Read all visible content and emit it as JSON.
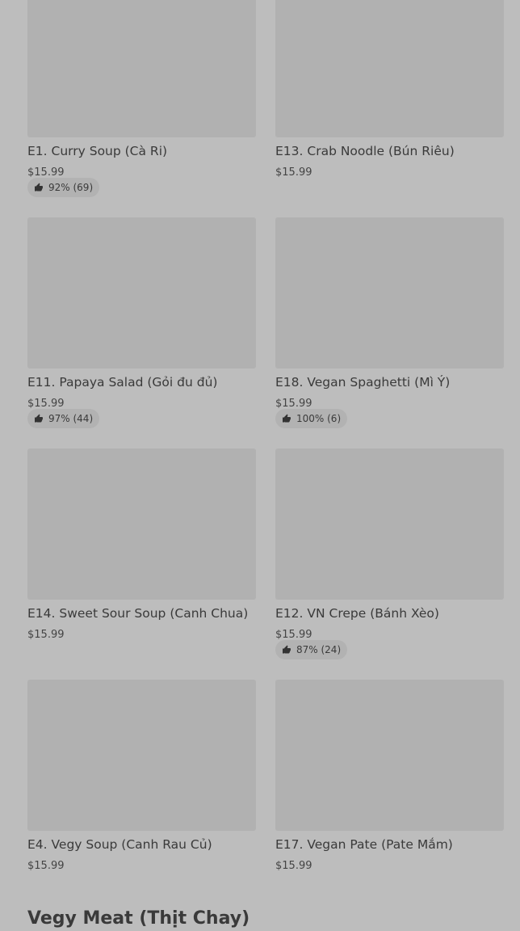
{
  "items": [
    {
      "title": "E1. Curry Soup (Cà Ri)",
      "price": "$15.99",
      "rating": "92% (69)"
    },
    {
      "title": "E13. Crab Noodle (Bún Riêu)",
      "price": "$15.99",
      "rating": ""
    },
    {
      "title": "E11. Papaya Salad (Gỏi đu đủ)",
      "price": "$15.99",
      "rating": "97% (44)"
    },
    {
      "title": "E18. Vegan Spaghetti (Mì Ý)",
      "price": "$15.99",
      "rating": "100% (6)"
    },
    {
      "title": "E14. Sweet Sour Soup (Canh Chua)",
      "price": "$15.99",
      "rating": ""
    },
    {
      "title": "E12. VN Crepe (Bánh Xèo)",
      "price": "$15.99",
      "rating": "87% (24)"
    },
    {
      "title": "E4. Vegy Soup (Canh Rau Củ)",
      "price": "$15.99",
      "rating": ""
    },
    {
      "title": "E17. Vegan Pate  (Pate Mắm)",
      "price": "$15.99",
      "rating": ""
    }
  ],
  "next_section": {
    "title": "Vegy Meat (Thịt Chay)"
  },
  "icons": {
    "rating": "thumbs-up-icon"
  }
}
